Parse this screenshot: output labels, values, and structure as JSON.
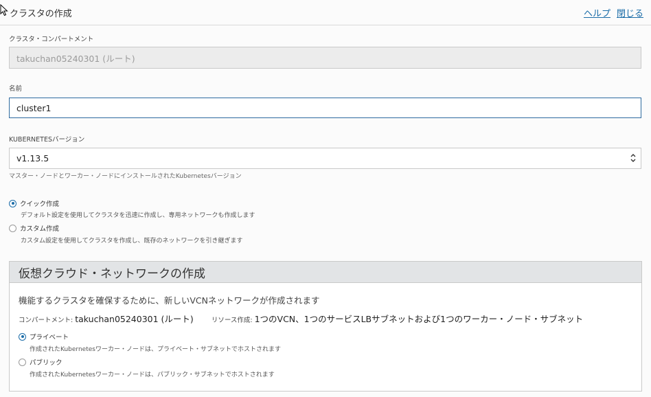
{
  "header": {
    "title": "クラスタの作成",
    "help_link": "ヘルプ",
    "close_link": "閉じる"
  },
  "compartment": {
    "label": "クラスタ・コンパートメント",
    "value": "takuchan05240301 (ルート)"
  },
  "name": {
    "label": "名前",
    "value": "cluster1"
  },
  "kubernetes_version": {
    "label": "KUBERNETESバージョン",
    "selected": "v1.13.5",
    "hint": "マスター・ノードとワーカー・ノードにインストールされたKubernetesバージョン"
  },
  "create_mode": {
    "options": [
      {
        "label": "クイック作成",
        "description": "デフォルト設定を使用してクラスタを迅速に作成し、専用ネットワークも作成します",
        "checked": true
      },
      {
        "label": "カスタム作成",
        "description": "カスタム設定を使用してクラスタを作成し、既存のネットワークを引き継ぎます",
        "checked": false
      }
    ]
  },
  "vcn": {
    "heading": "仮想クラウド・ネットワークの作成",
    "subtitle": "機能するクラスタを確保するために、新しいVCNネットワークが作成されます",
    "compartment_key": "コンパートメント: ",
    "compartment_value": "takuchan05240301 (ルート)",
    "resources_key": "リソース作成: ",
    "resources_value": "1つのVCN、1つのサービスLBサブネットおよび1つのワーカー・ノード・サブネット",
    "visibility_options": [
      {
        "label": "プライベート",
        "description": "作成されたKubernetesワーカー・ノードは、プライベート・サブネットでホストされます",
        "checked": true
      },
      {
        "label": "パブリック",
        "description": "作成されたKubernetesワーカー・ノードは、パブリック・サブネットでホストされます",
        "checked": false
      }
    ]
  },
  "colors": {
    "accent": "#1a6ca8",
    "panel_header": "#e2e4e6",
    "disabled_field": "#ececec"
  }
}
